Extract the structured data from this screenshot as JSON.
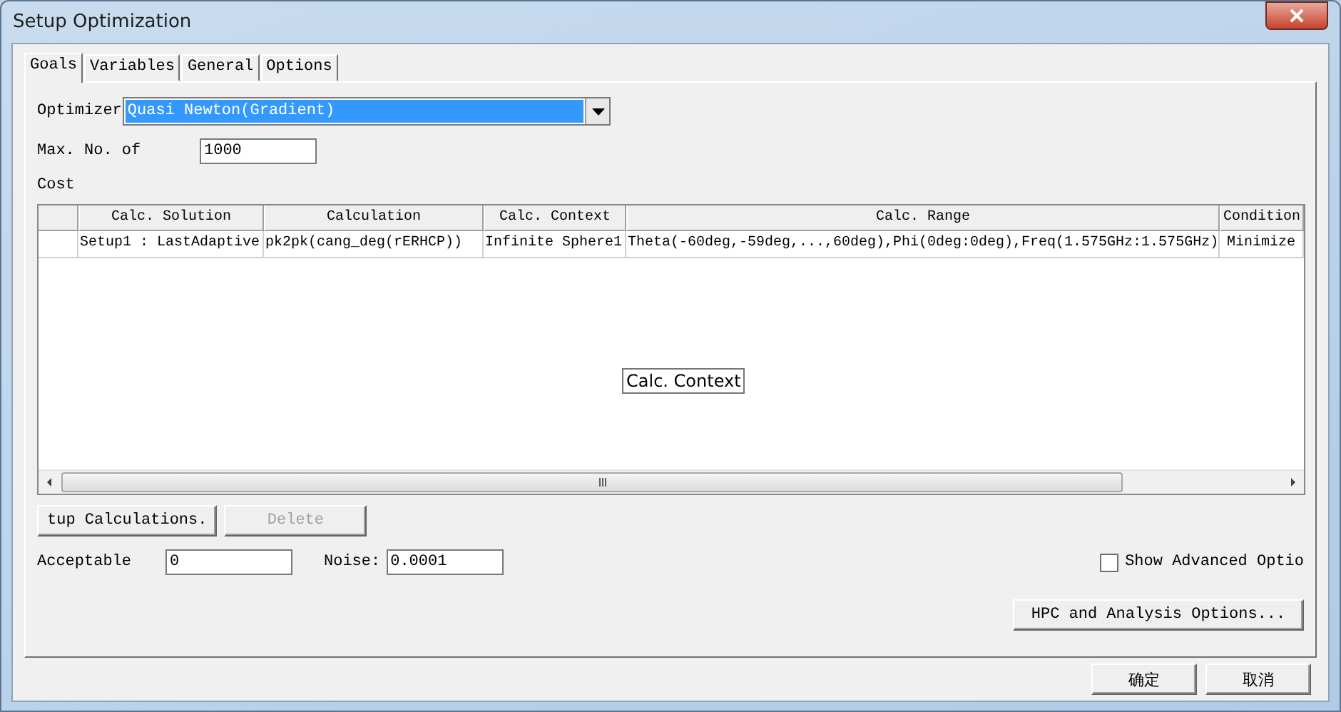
{
  "window": {
    "title": "Setup Optimization"
  },
  "tabs": [
    {
      "label": "Goals",
      "selected": true
    },
    {
      "label": "Variables",
      "selected": false
    },
    {
      "label": "General",
      "selected": false
    },
    {
      "label": "Options",
      "selected": false
    }
  ],
  "optimizer": {
    "label": "Optimizer",
    "value": "Quasi Newton(Gradient)"
  },
  "max_iterations": {
    "label": "Max. No. of",
    "value": "1000"
  },
  "cost_label": "Cost",
  "table": {
    "columns": [
      "Calc. Solution",
      "Calculation",
      "Calc. Context",
      "Calc. Range",
      "Condition"
    ],
    "rows": [
      {
        "cells": [
          "Setup1 : LastAdaptive",
          "pk2pk(cang_deg(rERHCP))",
          "Infinite Sphere1",
          "Theta(-60deg,-59deg,...,60deg),Phi(0deg:0deg),Freq(1.575GHz:1.575GHz)",
          "Minimize"
        ]
      }
    ]
  },
  "tooltip": "Calc. Context",
  "setup_button": {
    "label": "tup Calculations.",
    "disabled": false
  },
  "delete_button": {
    "label": "Delete",
    "disabled": true
  },
  "acceptable": {
    "label": "Acceptable",
    "value": "0"
  },
  "noise": {
    "label": "Noise:",
    "value": "0.0001"
  },
  "show_advanced": {
    "label": "Show Advanced Optio",
    "checked": false
  },
  "hpc_button": {
    "label": "HPC and Analysis Options...",
    "disabled": false
  },
  "dialog_buttons": [
    {
      "label": "确定",
      "disabled": false
    },
    {
      "label": "取消",
      "disabled": false
    }
  ]
}
